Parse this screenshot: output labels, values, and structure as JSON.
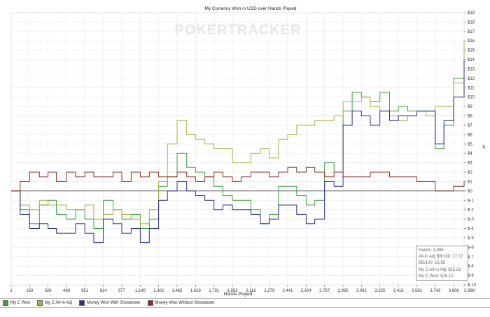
{
  "chart_data": {
    "type": "line",
    "title": "My Currency Won in USD over Hands Played",
    "watermark": "POKERTRACKER",
    "xlabel": "Hands Played",
    "ylabel": "$",
    "xlim": [
      1,
      3998
    ],
    "ylim": [
      -10,
      19
    ],
    "grid": true,
    "x_ticks": [
      "1",
      "163",
      "326",
      "489",
      "651",
      "814",
      "977",
      "1,140",
      "1,302",
      "1,465",
      "1,628",
      "1,791",
      "1,953",
      "2,116",
      "2,279",
      "2,441",
      "2,604",
      "2,767",
      "2,930",
      "3,092",
      "3,255",
      "3,418",
      "3,581",
      "3,743",
      "3,906",
      "3,998"
    ],
    "y_ticks": [
      "$19",
      "$18",
      "$17",
      "$16",
      "$15",
      "$14",
      "$13",
      "$12",
      "$11",
      "$10",
      "$9",
      "$8",
      "$7",
      "$6",
      "$5",
      "$4",
      "$3",
      "$2",
      "$1",
      "$0",
      "$-1",
      "$-2",
      "$-3",
      "$-4",
      "$-5",
      "$-6",
      "$-7",
      "$-8",
      "$-9",
      "$-10"
    ],
    "legend_position": "bottom",
    "series": [
      {
        "name": "My C Won",
        "color": "#3fa03f",
        "x": [
          1,
          80,
          163,
          250,
          326,
          400,
          489,
          570,
          651,
          730,
          814,
          900,
          977,
          1060,
          1140,
          1220,
          1302,
          1380,
          1465,
          1550,
          1628,
          1710,
          1791,
          1870,
          1953,
          2030,
          2116,
          2200,
          2279,
          2360,
          2441,
          2520,
          2604,
          2680,
          2767,
          2850,
          2930,
          3010,
          3092,
          3170,
          3255,
          3340,
          3418,
          3500,
          3581,
          3660,
          3743,
          3820,
          3906,
          3998
        ],
        "y": [
          0,
          -2,
          -3.5,
          -1.5,
          -1,
          -2.5,
          -3,
          -2,
          -3,
          -4,
          -1,
          -2,
          -3,
          -2.5,
          -4,
          -3,
          0.5,
          1.5,
          4,
          2.5,
          2,
          1.5,
          0.5,
          -0.5,
          -1,
          -1,
          -2,
          -3.5,
          -2.5,
          0.5,
          0.5,
          -0.5,
          -1.5,
          -1,
          3,
          2,
          8.5,
          10.5,
          10,
          9.5,
          10.5,
          8.5,
          9,
          8.5,
          8.5,
          8.5,
          4.5,
          7,
          12,
          15
        ]
      },
      {
        "name": "My C All-In Adj",
        "color": "#a8b040",
        "x": [
          1,
          80,
          163,
          250,
          326,
          400,
          489,
          570,
          651,
          730,
          814,
          900,
          977,
          1060,
          1140,
          1220,
          1302,
          1380,
          1465,
          1550,
          1628,
          1710,
          1791,
          1870,
          1953,
          2030,
          2116,
          2200,
          2279,
          2360,
          2441,
          2520,
          2604,
          2680,
          2767,
          2850,
          2930,
          3010,
          3092,
          3170,
          3255,
          3340,
          3418,
          3500,
          3581,
          3660,
          3743,
          3820,
          3906,
          3998
        ],
        "y": [
          0,
          -1.5,
          -2,
          -1,
          -1.5,
          -1.5,
          -2,
          -2,
          -1.5,
          -3,
          -2.5,
          -2,
          -2.5,
          -3,
          -3.5,
          -2,
          1,
          5,
          7.5,
          6,
          5.5,
          5,
          4.5,
          4.5,
          3,
          3,
          4,
          4.5,
          3.5,
          5.5,
          6,
          7,
          7,
          7.5,
          7.5,
          8,
          9.5,
          9.5,
          10,
          9,
          8.5,
          8,
          7.5,
          8,
          8.5,
          8,
          9,
          9,
          11.5,
          16
        ]
      },
      {
        "name": "Money Won With Showdown",
        "color": "#2e2e8e",
        "x": [
          1,
          80,
          163,
          250,
          326,
          400,
          489,
          570,
          651,
          730,
          814,
          900,
          977,
          1060,
          1140,
          1220,
          1302,
          1380,
          1465,
          1550,
          1628,
          1710,
          1791,
          1870,
          1953,
          2030,
          2116,
          2200,
          2279,
          2360,
          2441,
          2520,
          2604,
          2680,
          2767,
          2850,
          2930,
          3010,
          3092,
          3170,
          3255,
          3340,
          3418,
          3500,
          3581,
          3660,
          3743,
          3820,
          3906,
          3998
        ],
        "y": [
          0,
          -2.5,
          -4,
          -3.5,
          -4,
          -4.5,
          -4.5,
          -3.5,
          -4.5,
          -5.5,
          -3,
          -3.5,
          -4.5,
          -4,
          -5.5,
          -4,
          -1,
          0,
          1,
          0,
          -0.5,
          -1,
          -2,
          -1.5,
          -2,
          -2,
          -2.5,
          -3.5,
          -3,
          -1.5,
          -1.5,
          -2.5,
          -3.5,
          -3,
          1,
          0.5,
          7,
          8.5,
          8,
          7,
          8.5,
          7.5,
          8,
          8,
          8.5,
          8.5,
          5,
          7.5,
          10,
          14
        ]
      },
      {
        "name": "Money Won Without Showdown",
        "color": "#8e2e2e",
        "x": [
          1,
          80,
          163,
          250,
          326,
          400,
          489,
          570,
          651,
          730,
          814,
          900,
          977,
          1060,
          1140,
          1220,
          1302,
          1380,
          1465,
          1550,
          1628,
          1710,
          1791,
          1870,
          1953,
          2030,
          2116,
          2200,
          2279,
          2360,
          2441,
          2520,
          2604,
          2680,
          2767,
          2850,
          2930,
          3010,
          3092,
          3170,
          3255,
          3340,
          3418,
          3500,
          3581,
          3660,
          3743,
          3820,
          3906,
          3998
        ],
        "y": [
          0,
          1,
          2,
          1.5,
          2,
          1,
          2,
          1.5,
          2,
          1.5,
          1.5,
          2,
          1,
          2,
          1.5,
          2,
          1.5,
          1.5,
          2,
          1.5,
          1,
          1.5,
          2,
          1.5,
          1,
          1.5,
          2,
          2,
          1.5,
          2,
          2.5,
          2,
          2.5,
          2,
          1.5,
          2,
          1.5,
          1.5,
          1.5,
          2,
          2,
          1.5,
          1.5,
          1.5,
          1,
          1,
          0,
          0,
          0.5,
          1
        ]
      }
    ],
    "stats": [
      "Hands: 3,998",
      "All-In Adj BB/100: 17.72",
      "BB/100: 16.95",
      "My C All-In Adj: $15.81",
      "My C Won: $15.12"
    ]
  }
}
